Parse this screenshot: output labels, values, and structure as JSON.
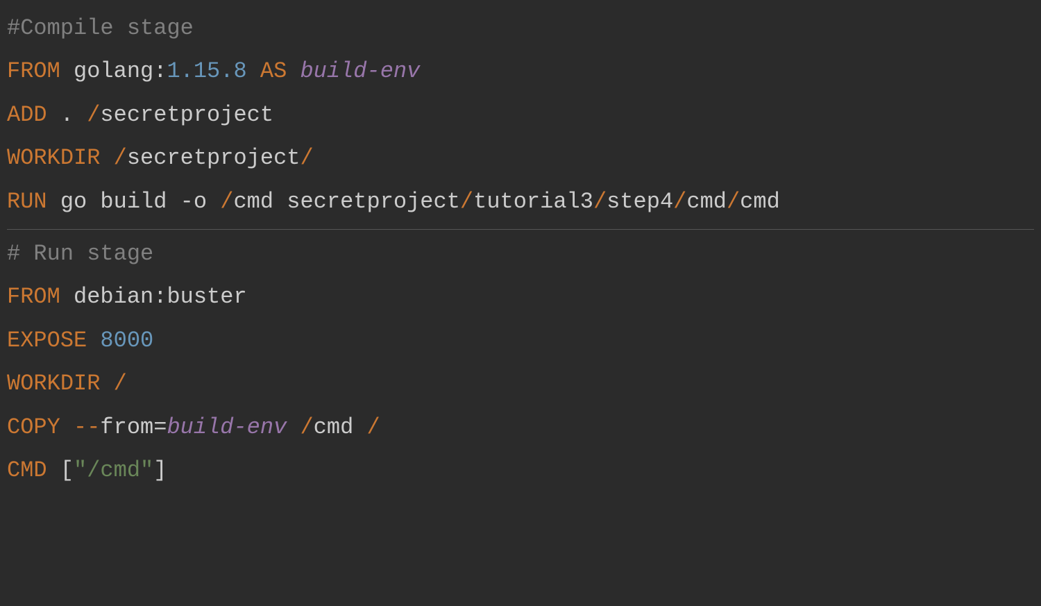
{
  "stage1": {
    "comment": "#Compile stage",
    "from_kw": "FROM",
    "image": " golang",
    "colon1": ":",
    "version": "1.15.8",
    "as_kw": " AS ",
    "alias": "build-env",
    "add_kw": "ADD",
    "add_args": " . ",
    "add_slash": "/",
    "add_path": "secretproject",
    "workdir_kw": "WORKDIR",
    "workdir_sp": " ",
    "workdir_slash1": "/",
    "workdir_path": "secretproject",
    "workdir_slash2": "/",
    "run_kw": "RUN",
    "run_pre": " go build -o ",
    "run_slash1": "/",
    "run_cmd": "cmd secretproject",
    "run_slash2": "/",
    "run_p1": "tutorial3",
    "run_slash3": "/",
    "run_p2": "step4",
    "run_slash4": "/",
    "run_p3": "cmd",
    "run_slash5": "/",
    "run_p4": "cmd"
  },
  "stage2": {
    "comment": "# Run stage",
    "from_kw": "FROM",
    "image": " debian",
    "colon": ":",
    "tag": "buster",
    "expose_kw": "EXPOSE",
    "expose_sp": " ",
    "expose_port": "8000",
    "workdir_kw": "WORKDIR",
    "workdir_sp": " ",
    "workdir_slash": "/",
    "copy_kw": "COPY",
    "copy_sp": " ",
    "copy_dash": "--",
    "copy_from": "from=",
    "copy_alias": "build-env",
    "copy_sp2": " ",
    "copy_slash1": "/",
    "copy_path": "cmd ",
    "copy_slash2": "/",
    "cmd_kw": "CMD",
    "cmd_sp": " ",
    "cmd_lbrack": "[",
    "cmd_str": "\"/cmd\"",
    "cmd_rbrack": "]"
  }
}
